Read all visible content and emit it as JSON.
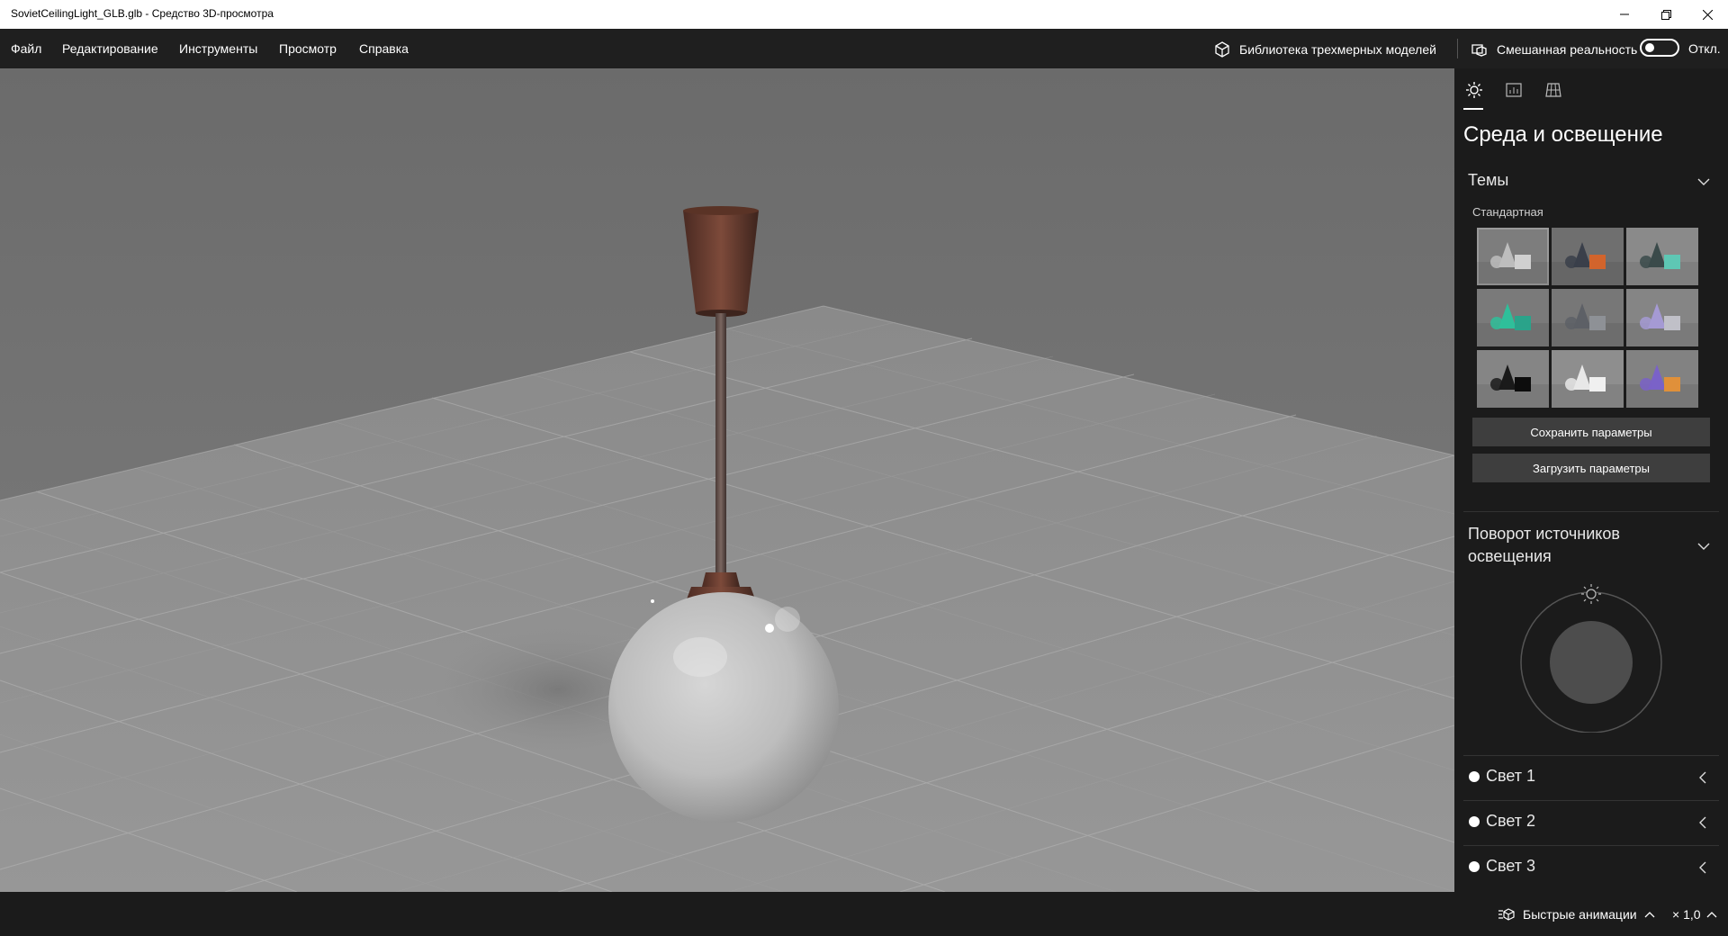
{
  "window": {
    "title": "SovietCeilingLight_GLB.glb - Средство 3D-просмотра"
  },
  "menu": {
    "items": [
      "Файл",
      "Редактирование",
      "Инструменты",
      "Просмотр",
      "Справка"
    ],
    "library_label": "Библиотека трехмерных моделей",
    "mixed_reality_label": "Смешанная реальность",
    "mixed_reality_state": "Откл.",
    "mixed_reality_on": false
  },
  "panel": {
    "title": "Среда и освещение",
    "themes": {
      "header": "Темы",
      "subheader": "Стандартная",
      "swatches": [
        {
          "bg": "#7d7d7d",
          "a": "#bdbdbd",
          "b": "#d0d0d0",
          "selected": true
        },
        {
          "bg": "#6f6f6f",
          "a": "#3a3f4a",
          "b": "#d2642c",
          "selected": false
        },
        {
          "bg": "#8a8a8a",
          "a": "#3a4a4a",
          "b": "#5ec7b4",
          "selected": false
        },
        {
          "bg": "#7a7a7a",
          "a": "#2fbf9a",
          "b": "#2aa38a",
          "selected": false
        },
        {
          "bg": "#777777",
          "a": "#5d6066",
          "b": "#8e9196",
          "selected": false
        },
        {
          "bg": "#858585",
          "a": "#a59ad4",
          "b": "#c0c0c8",
          "selected": false
        },
        {
          "bg": "#858585",
          "a": "#1a1a1a",
          "b": "#0d0d0d",
          "selected": false
        },
        {
          "bg": "#8e8e8e",
          "a": "#e8e8e8",
          "b": "#f0f0f0",
          "selected": false
        },
        {
          "bg": "#828282",
          "a": "#7a62c8",
          "b": "#e0903a",
          "selected": false
        }
      ],
      "save_label": "Сохранить параметры",
      "load_label": "Загрузить параметры"
    },
    "rotation": {
      "header_line1": "Поворот источников",
      "header_line2": "освещения"
    },
    "lights": [
      {
        "label": "Свет 1"
      },
      {
        "label": "Свет 2"
      },
      {
        "label": "Свет 3"
      }
    ]
  },
  "status": {
    "animations_label": "Быстрые анимации",
    "speed_label": "× 1,0"
  },
  "colors": {
    "viewport_floor": "#8f8f8f",
    "viewport_sky": "#6e6e6e",
    "panel_bg": "#1b1b1b",
    "button_bg": "#3e3e3e",
    "lamp_copper": "#6b3a2c"
  }
}
